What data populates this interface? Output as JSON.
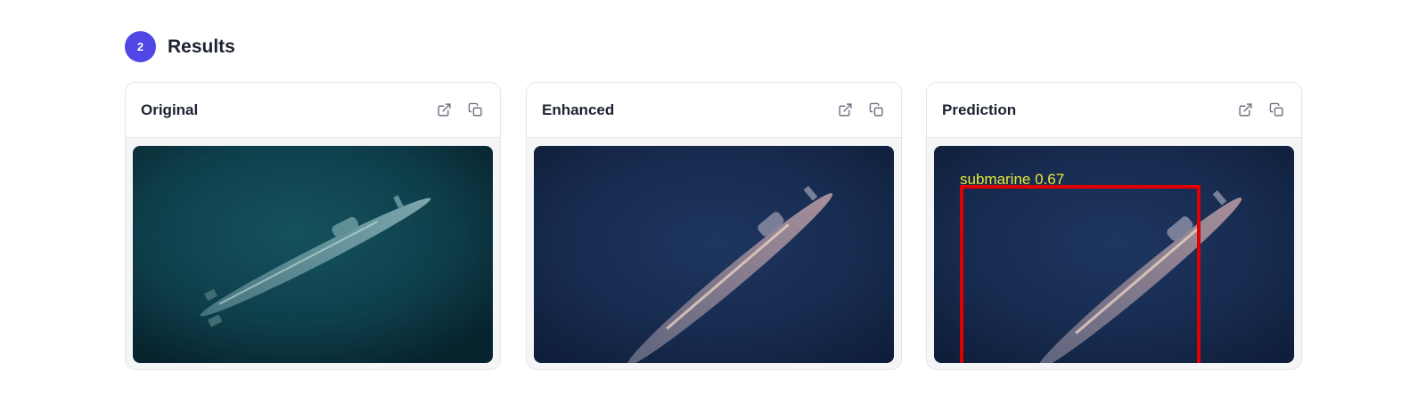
{
  "section": {
    "step_number": "2",
    "title": "Results"
  },
  "cards": [
    {
      "title": "Original",
      "icons": [
        "open-external-icon",
        "copy-icon"
      ]
    },
    {
      "title": "Enhanced",
      "icons": [
        "open-external-icon",
        "copy-icon"
      ]
    },
    {
      "title": "Prediction",
      "icons": [
        "open-external-icon",
        "copy-icon"
      ],
      "detection": {
        "label": "submarine 0.67",
        "box_color": "#e00000",
        "label_color": "#e8e83a"
      }
    }
  ],
  "colors": {
    "accent": "#4f46e5"
  }
}
